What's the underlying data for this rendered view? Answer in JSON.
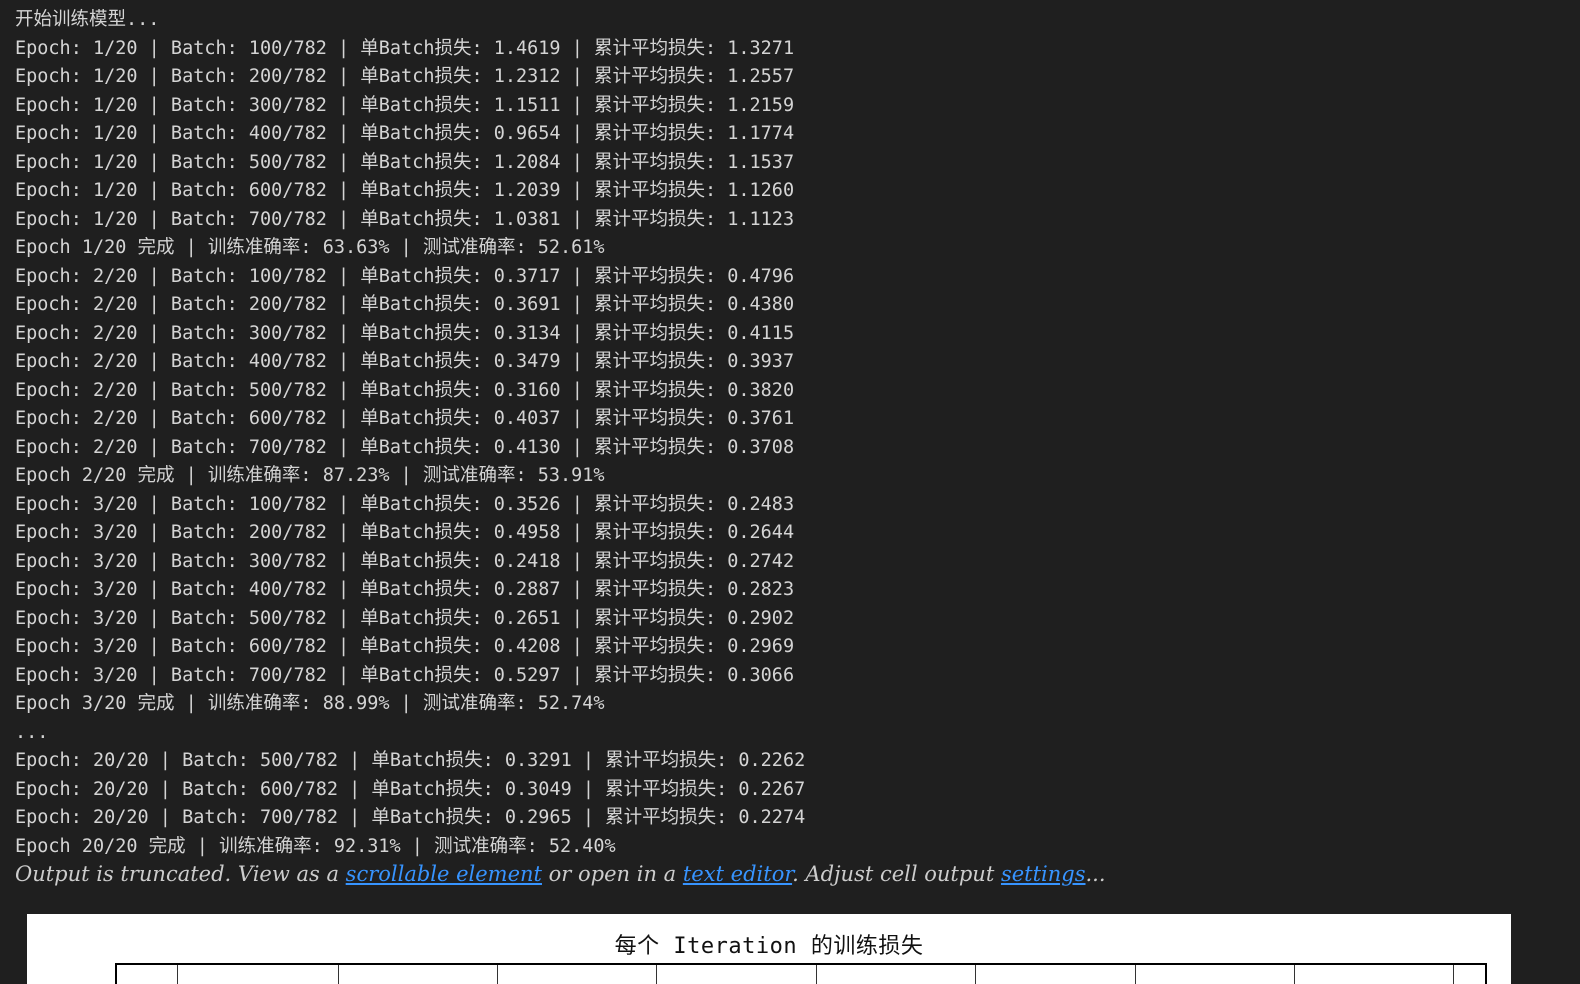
{
  "log": [
    "开始训练模型...",
    "Epoch: 1/20 | Batch: 100/782 | 单Batch损失: 1.4619 | 累计平均损失: 1.3271",
    "Epoch: 1/20 | Batch: 200/782 | 单Batch损失: 1.2312 | 累计平均损失: 1.2557",
    "Epoch: 1/20 | Batch: 300/782 | 单Batch损失: 1.1511 | 累计平均损失: 1.2159",
    "Epoch: 1/20 | Batch: 400/782 | 单Batch损失: 0.9654 | 累计平均损失: 1.1774",
    "Epoch: 1/20 | Batch: 500/782 | 单Batch损失: 1.2084 | 累计平均损失: 1.1537",
    "Epoch: 1/20 | Batch: 600/782 | 单Batch损失: 1.2039 | 累计平均损失: 1.1260",
    "Epoch: 1/20 | Batch: 700/782 | 单Batch损失: 1.0381 | 累计平均损失: 1.1123",
    "Epoch 1/20 完成 | 训练准确率: 63.63% | 测试准确率: 52.61%",
    "Epoch: 2/20 | Batch: 100/782 | 单Batch损失: 0.3717 | 累计平均损失: 0.4796",
    "Epoch: 2/20 | Batch: 200/782 | 单Batch损失: 0.3691 | 累计平均损失: 0.4380",
    "Epoch: 2/20 | Batch: 300/782 | 单Batch损失: 0.3134 | 累计平均损失: 0.4115",
    "Epoch: 2/20 | Batch: 400/782 | 单Batch损失: 0.3479 | 累计平均损失: 0.3937",
    "Epoch: 2/20 | Batch: 500/782 | 单Batch损失: 0.3160 | 累计平均损失: 0.3820",
    "Epoch: 2/20 | Batch: 600/782 | 单Batch损失: 0.4037 | 累计平均损失: 0.3761",
    "Epoch: 2/20 | Batch: 700/782 | 单Batch损失: 0.4130 | 累计平均损失: 0.3708",
    "Epoch 2/20 完成 | 训练准确率: 87.23% | 测试准确率: 53.91%",
    "Epoch: 3/20 | Batch: 100/782 | 单Batch损失: 0.3526 | 累计平均损失: 0.2483",
    "Epoch: 3/20 | Batch: 200/782 | 单Batch损失: 0.4958 | 累计平均损失: 0.2644",
    "Epoch: 3/20 | Batch: 300/782 | 单Batch损失: 0.2418 | 累计平均损失: 0.2742",
    "Epoch: 3/20 | Batch: 400/782 | 单Batch损失: 0.2887 | 累计平均损失: 0.2823",
    "Epoch: 3/20 | Batch: 500/782 | 单Batch损失: 0.2651 | 累计平均损失: 0.2902",
    "Epoch: 3/20 | Batch: 600/782 | 单Batch损失: 0.4208 | 累计平均损失: 0.2969",
    "Epoch: 3/20 | Batch: 700/782 | 单Batch损失: 0.5297 | 累计平均损失: 0.3066",
    "Epoch 3/20 完成 | 训练准确率: 88.99% | 测试准确率: 52.74%",
    "...",
    "Epoch: 20/20 | Batch: 500/782 | 单Batch损失: 0.3291 | 累计平均损失: 0.2262",
    "Epoch: 20/20 | Batch: 600/782 | 单Batch损失: 0.3049 | 累计平均损失: 0.2267",
    "Epoch: 20/20 | Batch: 700/782 | 单Batch损失: 0.2965 | 累计平均损失: 0.2274",
    "Epoch 20/20 完成 | 训练准确率: 92.31% | 测试准确率: 52.40%"
  ],
  "truncation": {
    "prefix": "Output is truncated. View as a ",
    "link_scrollable": "scrollable element",
    "middle": " or open in a ",
    "link_editor": "text editor",
    "suffix": ". Adjust cell output ",
    "link_settings": "settings",
    "ellipsis": "..."
  },
  "figure": {
    "title": "每个 Iteration 的训练损失"
  }
}
